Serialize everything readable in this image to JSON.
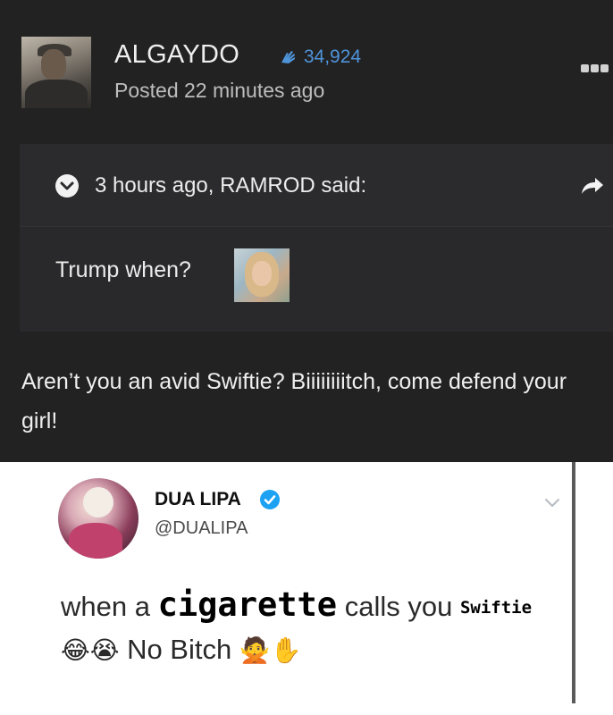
{
  "post": {
    "username": "ALGAYDO",
    "reputation": "34,924",
    "posted": "Posted 22 minutes ago",
    "reply": "Aren’t you an avid Swiftie? Biiiiiiiitch, come defend your girl!"
  },
  "quote": {
    "attribution": "3 hours ago, RAMROD said:",
    "text": "Trump when?"
  },
  "tweet": {
    "name": "DUA LIPA",
    "handle": "@DUALIPA",
    "line1_a": "when a",
    "line1_b": "cigarette",
    "line1_c": "calls you",
    "line1_d": "Swiftie",
    "emojis_a": "😂😭",
    "line2_text": "No Bitch",
    "emojis_b": "🙅✋"
  },
  "colors": {
    "forum_bg": "#222223",
    "quote_bg": "#2b2b2d",
    "reputation_blue": "#4f94d9",
    "verified_blue": "#1da1f2"
  },
  "icons": {
    "reputation": "hand-icon",
    "more": "ellipsis-icon",
    "quote_toggle": "chevron-down-icon",
    "share": "share-arrow-icon",
    "verified": "verified-badge-icon",
    "tweet_menu": "caret-down-icon"
  }
}
